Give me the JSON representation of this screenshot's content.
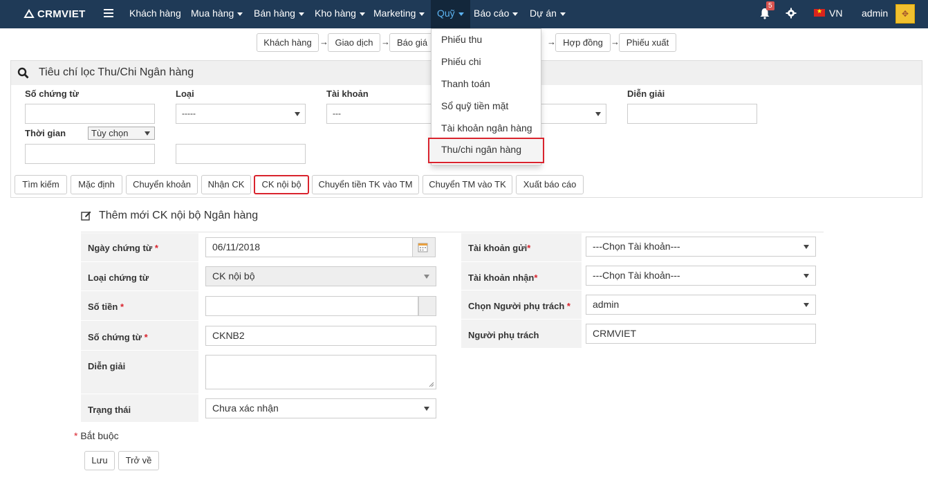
{
  "navbar": {
    "brand": "CRMVIET",
    "menu": [
      {
        "label": "Khách hàng",
        "caret": false
      },
      {
        "label": "Mua hàng",
        "caret": true
      },
      {
        "label": "Bán hàng",
        "caret": true
      },
      {
        "label": "Kho hàng",
        "caret": true
      },
      {
        "label": "Marketing",
        "caret": true
      },
      {
        "label": "Quỹ",
        "caret": true
      },
      {
        "label": "Báo cáo",
        "caret": true
      },
      {
        "label": "Dự án",
        "caret": true
      }
    ],
    "notification_count": "5",
    "language": "VN",
    "username": "admin",
    "accent_color": "#5cb3f0",
    "bg_color": "#1f3a57"
  },
  "flow": [
    "Khách hàng",
    "Giao dịch",
    "Báo giá",
    "Hợp đồng",
    "Phiếu xuất"
  ],
  "dropdown": {
    "items": [
      "Phiếu thu",
      "Phiếu chi",
      "Thanh toán",
      "Sổ quỹ tiền mặt",
      "Tài khoản ngân hàng",
      "Thu/chi ngân hàng"
    ],
    "selected": "Thu/chi ngân hàng"
  },
  "filter": {
    "title": "Tiêu chí lọc Thu/Chi Ngân hàng",
    "labels": {
      "so_chung_tu": "Số chứng từ",
      "loai": "Loại",
      "tai_khoan": "Tài khoản",
      "dien_giai": "Diễn giải",
      "thoi_gian": "Thời gian"
    },
    "loai_value": "-----",
    "tai_khoan_value": "---",
    "thoi_gian_option": "Tùy chọn",
    "buttons": [
      "Tìm kiếm",
      "Mặc định",
      "Chuyển khoản",
      "Nhận CK",
      "CK nội bộ",
      "Chuyển tiền TK vào TM",
      "Chuyển TM vào TK",
      "Xuất báo cáo"
    ],
    "highlighted_button": "CK nội bộ"
  },
  "form": {
    "title": "Thêm mới CK nội bộ Ngân hàng",
    "left": {
      "ngay_chung_tu": {
        "label": "Ngày chứng từ",
        "value": "06/11/2018"
      },
      "loai_chung_tu": {
        "label": "Loại chứng từ",
        "value": "CK nội bộ"
      },
      "so_tien": {
        "label": "Số tiền",
        "value": ""
      },
      "so_chung_tu": {
        "label": "Số chứng từ",
        "value": "CKNB2"
      },
      "dien_giai": {
        "label": "Diễn giải",
        "value": ""
      },
      "trang_thai": {
        "label": "Trạng thái",
        "value": "Chưa xác nhận"
      }
    },
    "right": {
      "tai_khoan_gui": {
        "label": "Tài khoản gửi",
        "value": "---Chọn Tài khoản---"
      },
      "tai_khoan_nhan": {
        "label": "Tài khoản nhận",
        "value": "---Chọn Tài khoản---"
      },
      "nguoi_phu_trach_select": {
        "label": "Chọn Người phụ trách",
        "value": "admin"
      },
      "nguoi_phu_trach": {
        "label": "Người phụ trách",
        "value": "CRMVIET"
      }
    },
    "required_mark": "*",
    "required_note": "Bắt buộc",
    "save_label": "Lưu",
    "back_label": "Trở về"
  }
}
